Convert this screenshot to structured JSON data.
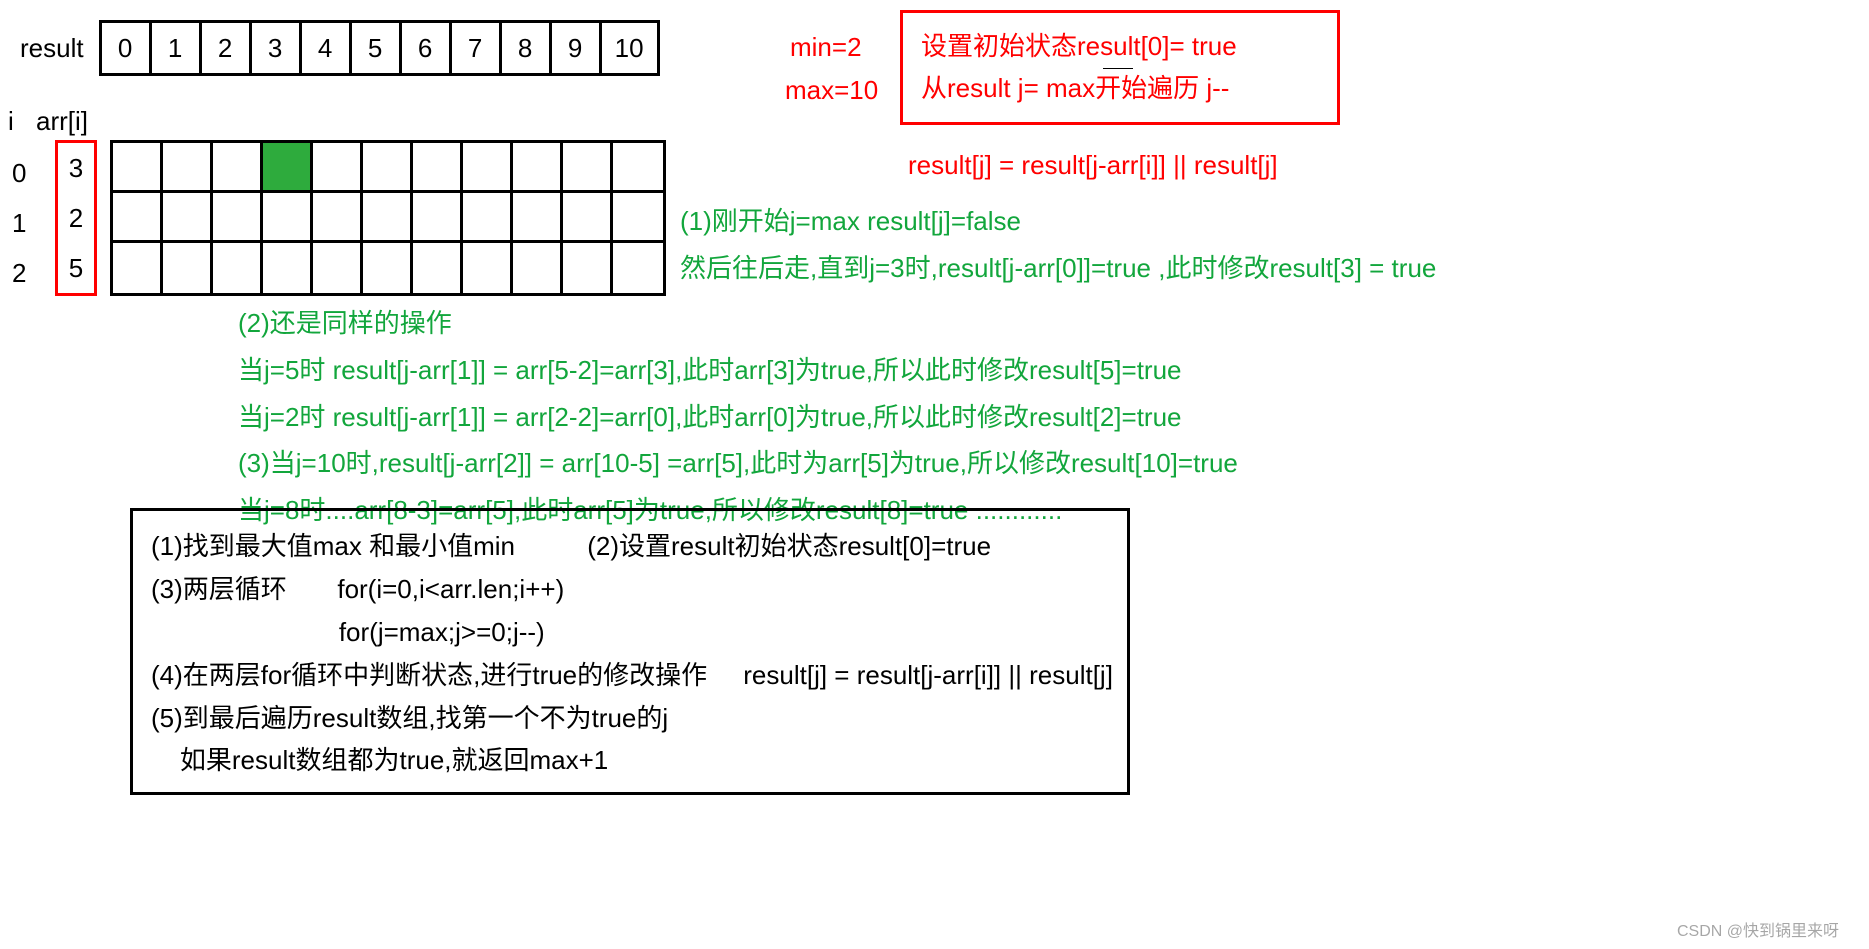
{
  "result_label": "result",
  "result_cells": [
    "0",
    "1",
    "2",
    "3",
    "4",
    "5",
    "6",
    "7",
    "8",
    "9",
    "10"
  ],
  "i_label": "i",
  "arri_label": "arr[i]",
  "row_indices": [
    "0",
    "1",
    "2"
  ],
  "arr_values": [
    "3",
    "2",
    "5"
  ],
  "highlighted_cell": {
    "row": 0,
    "col": 3
  },
  "grid_rows": 3,
  "grid_cols": 11,
  "min_text": "min=2",
  "max_text": "max=10",
  "red_box_line1": "设置初始状态result[0]= true",
  "red_box_line2": "从result j= max开始遍历  j--",
  "formula": "result[j] = result[j-arr[i]] || result[j]",
  "green1_line1": "(1)刚开始j=max  result[j]=false",
  "green1_line2": "然后往后走,直到j=3时,result[j-arr[0]]=true ,此时修改result[3] = true",
  "green2_line1": "(2)还是同样的操作",
  "green2_line2": "当j=5时 result[j-arr[1]] = arr[5-2]=arr[3],此时arr[3]为true,所以此时修改result[5]=true",
  "green2_line3": "当j=2时 result[j-arr[1]] = arr[2-2]=arr[0],此时arr[0]为true,所以此时修改result[2]=true",
  "green2_line4": "(3)当j=10时,result[j-arr[2]] = arr[10-5] =arr[5],此时为arr[5]为true,所以修改result[10]=true",
  "green2_line5": "当j=8时....arr[8-3]=arr[5],此时arr[5]为true,所以修改result[8]=true ............",
  "summary_line1": "(1)找到最大值max 和最小值min          (2)设置result初始状态result[0]=true",
  "summary_line2": "(3)两层循环       for(i=0,i<arr.len;i++)",
  "summary_line3": "                          for(j=max;j>=0;j--)",
  "summary_line4": "(4)在两层for循环中判断状态,进行true的修改操作     result[j] = result[j-arr[i]] || result[j]",
  "summary_line5": "(5)到最后遍历result数组,找第一个不为true的j",
  "summary_line6": "    如果result数组都为true,就返回max+1",
  "watermark": "CSDN @快到锅里来呀"
}
